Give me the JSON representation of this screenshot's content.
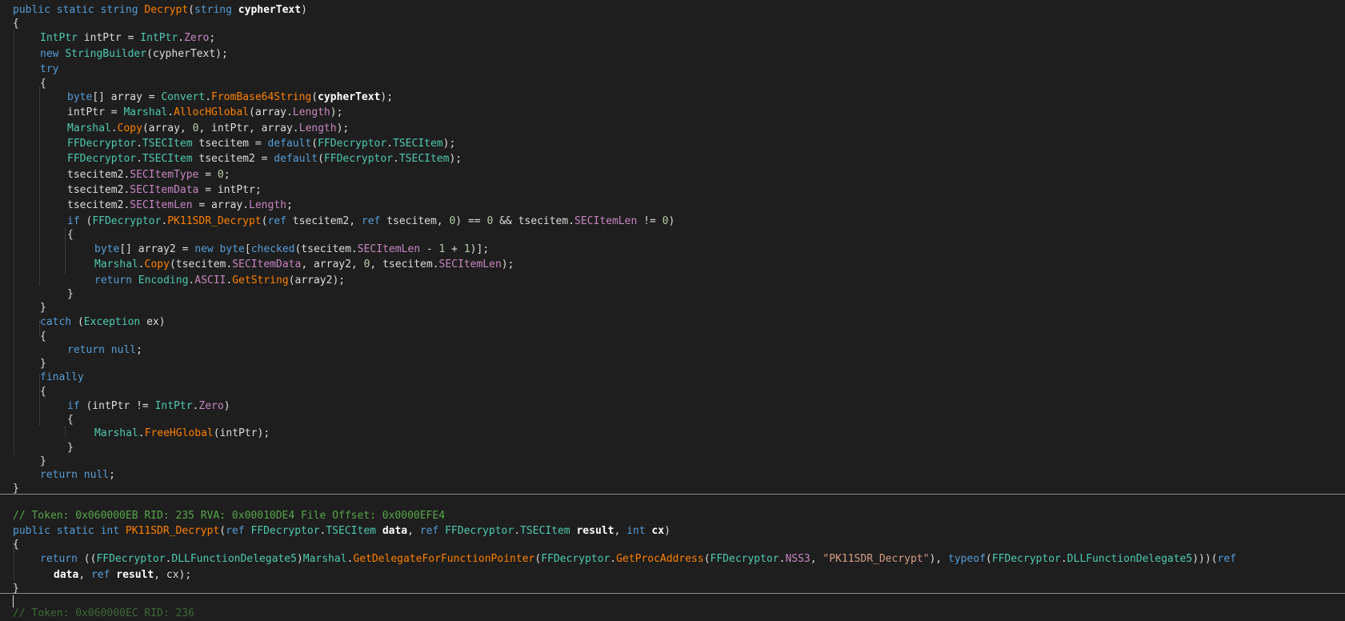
{
  "code": {
    "lines": [
      [
        [
          "k",
          "public static string "
        ],
        [
          "m",
          "Decrypt"
        ],
        [
          "d",
          "("
        ],
        [
          "k",
          "string "
        ],
        [
          "v",
          "cypherText"
        ],
        [
          "d",
          ")"
        ]
      ],
      [
        [
          "d",
          "{"
        ]
      ],
      [
        [
          "t",
          "IntPtr"
        ],
        [
          "d",
          " intPtr = "
        ],
        [
          "t",
          "IntPtr"
        ],
        [
          "d",
          "."
        ],
        [
          "p",
          "Zero"
        ],
        [
          "d",
          ";"
        ]
      ],
      [
        [
          "k",
          "new "
        ],
        [
          "t",
          "StringBuilder"
        ],
        [
          "d",
          "(cypherText);"
        ]
      ],
      [
        [
          "k",
          "try"
        ]
      ],
      [
        [
          "d",
          "{"
        ]
      ],
      [
        [
          "k",
          "byte"
        ],
        [
          "d",
          "[] array = "
        ],
        [
          "t",
          "Convert"
        ],
        [
          "d",
          "."
        ],
        [
          "m",
          "FromBase64String"
        ],
        [
          "d",
          "("
        ],
        [
          "v",
          "cypherText"
        ],
        [
          "d",
          ");"
        ]
      ],
      [
        [
          "d",
          "intPtr = "
        ],
        [
          "t",
          "Marshal"
        ],
        [
          "d",
          "."
        ],
        [
          "m",
          "AllocHGlobal"
        ],
        [
          "d",
          "(array."
        ],
        [
          "p",
          "Length"
        ],
        [
          "d",
          ");"
        ]
      ],
      [
        [
          "t",
          "Marshal"
        ],
        [
          "d",
          "."
        ],
        [
          "m",
          "Copy"
        ],
        [
          "d",
          "(array, "
        ],
        [
          "n",
          "0"
        ],
        [
          "d",
          ", intPtr, array."
        ],
        [
          "p",
          "Length"
        ],
        [
          "d",
          ");"
        ]
      ],
      [
        [
          "t",
          "FFDecryptor"
        ],
        [
          "d",
          "."
        ],
        [
          "t",
          "TSECItem"
        ],
        [
          "d",
          " tsecitem = "
        ],
        [
          "k",
          "default"
        ],
        [
          "d",
          "("
        ],
        [
          "t",
          "FFDecryptor"
        ],
        [
          "d",
          "."
        ],
        [
          "t",
          "TSECItem"
        ],
        [
          "d",
          ");"
        ]
      ],
      [
        [
          "t",
          "FFDecryptor"
        ],
        [
          "d",
          "."
        ],
        [
          "t",
          "TSECItem"
        ],
        [
          "d",
          " tsecitem2 = "
        ],
        [
          "k",
          "default"
        ],
        [
          "d",
          "("
        ],
        [
          "t",
          "FFDecryptor"
        ],
        [
          "d",
          "."
        ],
        [
          "t",
          "TSECItem"
        ],
        [
          "d",
          ");"
        ]
      ],
      [
        [
          "d",
          "tsecitem2."
        ],
        [
          "p",
          "SECItemType"
        ],
        [
          "d",
          " = "
        ],
        [
          "n",
          "0"
        ],
        [
          "d",
          ";"
        ]
      ],
      [
        [
          "d",
          "tsecitem2."
        ],
        [
          "p",
          "SECItemData"
        ],
        [
          "d",
          " = intPtr;"
        ]
      ],
      [
        [
          "d",
          "tsecitem2."
        ],
        [
          "p",
          "SECItemLen"
        ],
        [
          "d",
          " = array."
        ],
        [
          "p",
          "Length"
        ],
        [
          "d",
          ";"
        ]
      ],
      [
        [
          "k",
          "if "
        ],
        [
          "d",
          "("
        ],
        [
          "t",
          "FFDecryptor"
        ],
        [
          "d",
          "."
        ],
        [
          "m",
          "PK11SDR_Decrypt"
        ],
        [
          "d",
          "("
        ],
        [
          "k",
          "ref "
        ],
        [
          "d",
          "tsecitem2, "
        ],
        [
          "k",
          "ref "
        ],
        [
          "d",
          "tsecitem, "
        ],
        [
          "n",
          "0"
        ],
        [
          "d",
          ") == "
        ],
        [
          "n",
          "0"
        ],
        [
          "d",
          " && tsecitem."
        ],
        [
          "p",
          "SECItemLen"
        ],
        [
          "d",
          " != "
        ],
        [
          "n",
          "0"
        ],
        [
          "d",
          ")"
        ]
      ],
      [
        [
          "d",
          "{"
        ]
      ],
      [
        [
          "k",
          "byte"
        ],
        [
          "d",
          "[] array2 = "
        ],
        [
          "k",
          "new byte"
        ],
        [
          "d",
          "["
        ],
        [
          "k",
          "checked"
        ],
        [
          "d",
          "(tsecitem."
        ],
        [
          "p",
          "SECItemLen"
        ],
        [
          "d",
          " - "
        ],
        [
          "n",
          "1"
        ],
        [
          "d",
          " + "
        ],
        [
          "n",
          "1"
        ],
        [
          "d",
          ")];"
        ]
      ],
      [
        [
          "t",
          "Marshal"
        ],
        [
          "d",
          "."
        ],
        [
          "m",
          "Copy"
        ],
        [
          "d",
          "(tsecitem."
        ],
        [
          "p",
          "SECItemData"
        ],
        [
          "d",
          ", array2, "
        ],
        [
          "n",
          "0"
        ],
        [
          "d",
          ", tsecitem."
        ],
        [
          "p",
          "SECItemLen"
        ],
        [
          "d",
          ");"
        ]
      ],
      [
        [
          "k",
          "return "
        ],
        [
          "t",
          "Encoding"
        ],
        [
          "d",
          "."
        ],
        [
          "p",
          "ASCII"
        ],
        [
          "d",
          "."
        ],
        [
          "m",
          "GetString"
        ],
        [
          "d",
          "(array2);"
        ]
      ],
      [
        [
          "d",
          "}"
        ]
      ],
      [
        [
          "d",
          "}"
        ]
      ],
      [
        [
          "k",
          "catch "
        ],
        [
          "d",
          "("
        ],
        [
          "t",
          "Exception"
        ],
        [
          "d",
          " ex)"
        ]
      ],
      [
        [
          "d",
          "{"
        ]
      ],
      [
        [
          "k",
          "return null"
        ],
        [
          "d",
          ";"
        ]
      ],
      [
        [
          "d",
          "}"
        ]
      ],
      [
        [
          "k",
          "finally"
        ]
      ],
      [
        [
          "d",
          "{"
        ]
      ],
      [
        [
          "k",
          "if "
        ],
        [
          "d",
          "(intPtr != "
        ],
        [
          "t",
          "IntPtr"
        ],
        [
          "d",
          "."
        ],
        [
          "p",
          "Zero"
        ],
        [
          "d",
          ")"
        ]
      ],
      [
        [
          "d",
          "{"
        ]
      ],
      [
        [
          "t",
          "Marshal"
        ],
        [
          "d",
          "."
        ],
        [
          "m",
          "FreeHGlobal"
        ],
        [
          "d",
          "(intPtr);"
        ]
      ],
      [
        [
          "d",
          "}"
        ]
      ],
      [
        [
          "d",
          "}"
        ]
      ],
      [
        [
          "k",
          "return null"
        ],
        [
          "d",
          ";"
        ]
      ],
      [
        [
          "d",
          "}"
        ]
      ],
      [
        [
          "c",
          "// Token: 0x060000EB RID: 235 RVA: 0x00010DE4 File Offset: 0x0000EFE4"
        ]
      ],
      [
        [
          "k",
          "public static int "
        ],
        [
          "m",
          "PK11SDR_Decrypt"
        ],
        [
          "d",
          "("
        ],
        [
          "k",
          "ref "
        ],
        [
          "t",
          "FFDecryptor"
        ],
        [
          "d",
          "."
        ],
        [
          "t",
          "TSECItem"
        ],
        [
          "d",
          " "
        ],
        [
          "v",
          "data"
        ],
        [
          "d",
          ", "
        ],
        [
          "k",
          "ref "
        ],
        [
          "t",
          "FFDecryptor"
        ],
        [
          "d",
          "."
        ],
        [
          "t",
          "TSECItem"
        ],
        [
          "d",
          " "
        ],
        [
          "v",
          "result"
        ],
        [
          "d",
          ", "
        ],
        [
          "k",
          "int "
        ],
        [
          "v",
          "cx"
        ],
        [
          "d",
          ")"
        ]
      ],
      [
        [
          "d",
          "{"
        ]
      ],
      [
        [
          "k",
          "return "
        ],
        [
          "d",
          "(("
        ],
        [
          "t",
          "FFDecryptor"
        ],
        [
          "d",
          "."
        ],
        [
          "t",
          "DLLFunctionDelegate5"
        ],
        [
          "d",
          ")"
        ],
        [
          "t",
          "Marshal"
        ],
        [
          "d",
          "."
        ],
        [
          "m",
          "GetDelegateForFunctionPointer"
        ],
        [
          "d",
          "("
        ],
        [
          "t",
          "FFDecryptor"
        ],
        [
          "d",
          "."
        ],
        [
          "m",
          "GetProcAddress"
        ],
        [
          "d",
          "("
        ],
        [
          "t",
          "FFDecryptor"
        ],
        [
          "d",
          "."
        ],
        [
          "p",
          "NSS3"
        ],
        [
          "d",
          ", "
        ],
        [
          "s",
          "\"PK11SDR_Decrypt\""
        ],
        [
          "d",
          "), "
        ],
        [
          "k",
          "typeof"
        ],
        [
          "d",
          "("
        ],
        [
          "t",
          "FFDecryptor"
        ],
        [
          "d",
          "."
        ],
        [
          "t",
          "DLLFunctionDelegate5"
        ],
        [
          "d",
          ")))("
        ],
        [
          "k",
          "ref"
        ]
      ],
      [
        [
          "v",
          "data"
        ],
        [
          "d",
          ", "
        ],
        [
          "k",
          "ref "
        ],
        [
          "v",
          "result"
        ],
        [
          "d",
          ", cx);"
        ]
      ],
      [
        [
          "d",
          "}"
        ]
      ],
      [
        [
          "c",
          "// Token: 0x060000EC RID: 236"
        ]
      ]
    ]
  }
}
